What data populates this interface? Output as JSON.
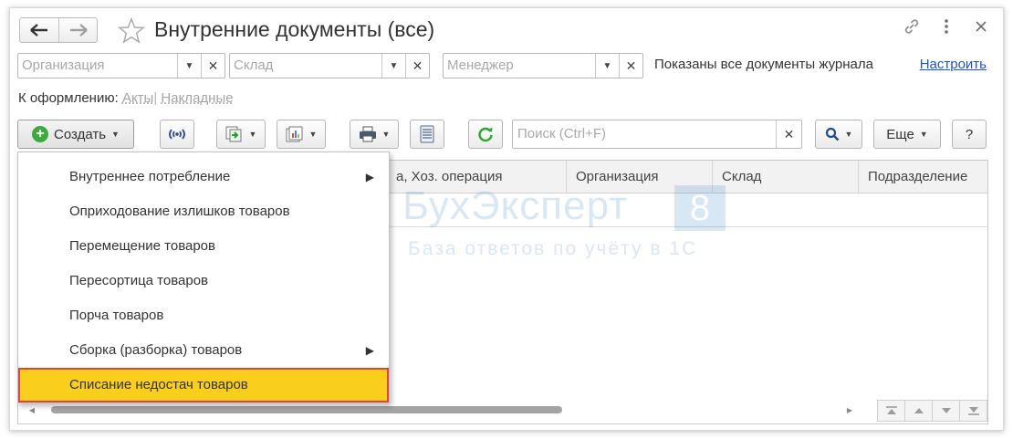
{
  "window": {
    "title": "Внутренние документы (все)",
    "nav_back_glyph": "🡐",
    "nav_forward_glyph": "🡒",
    "icons": [
      "link-icon",
      "more-icon",
      "close-icon"
    ]
  },
  "filters": {
    "organization_placeholder": "Организация",
    "warehouse_placeholder": "Склад",
    "manager_placeholder": "Менеджер",
    "journal_note": "Показаны все документы журнала",
    "setup_link": "Настроить"
  },
  "todo": {
    "label": "К оформлению:",
    "acts": "Акты",
    "separator": "|",
    "invoices": "Накладные"
  },
  "toolbar": {
    "create_label": "Создать",
    "search_placeholder": "Поиск (Ctrl+F)",
    "more_label": "Еще",
    "help_label": "?"
  },
  "table": {
    "columns": [
      "а, Хоз. операция",
      "Организация",
      "Склад",
      "Подразделение"
    ]
  },
  "menu": {
    "items": [
      {
        "label": "Внутреннее потребление",
        "submenu": true
      },
      {
        "label": "Оприходование излишков товаров",
        "submenu": false
      },
      {
        "label": "Перемещение товаров",
        "submenu": false
      },
      {
        "label": "Пересортица товаров",
        "submenu": false
      },
      {
        "label": "Порча товаров",
        "submenu": false
      },
      {
        "label": "Сборка (разборка) товаров",
        "submenu": true
      },
      {
        "label": "Списание недостач товаров",
        "submenu": false,
        "highlighted": true
      }
    ]
  },
  "watermark": {
    "name": "БухЭксперт",
    "badge": "8",
    "tagline": "База ответов по учёту в 1С"
  },
  "colors": {
    "highlight_fill": "#f9ce1c",
    "highlight_border": "#e0443a",
    "link": "#1a56c4",
    "create_plus": "#3eaa3e",
    "refresh": "#2fa52f",
    "watermark": "#2e7dc4"
  }
}
